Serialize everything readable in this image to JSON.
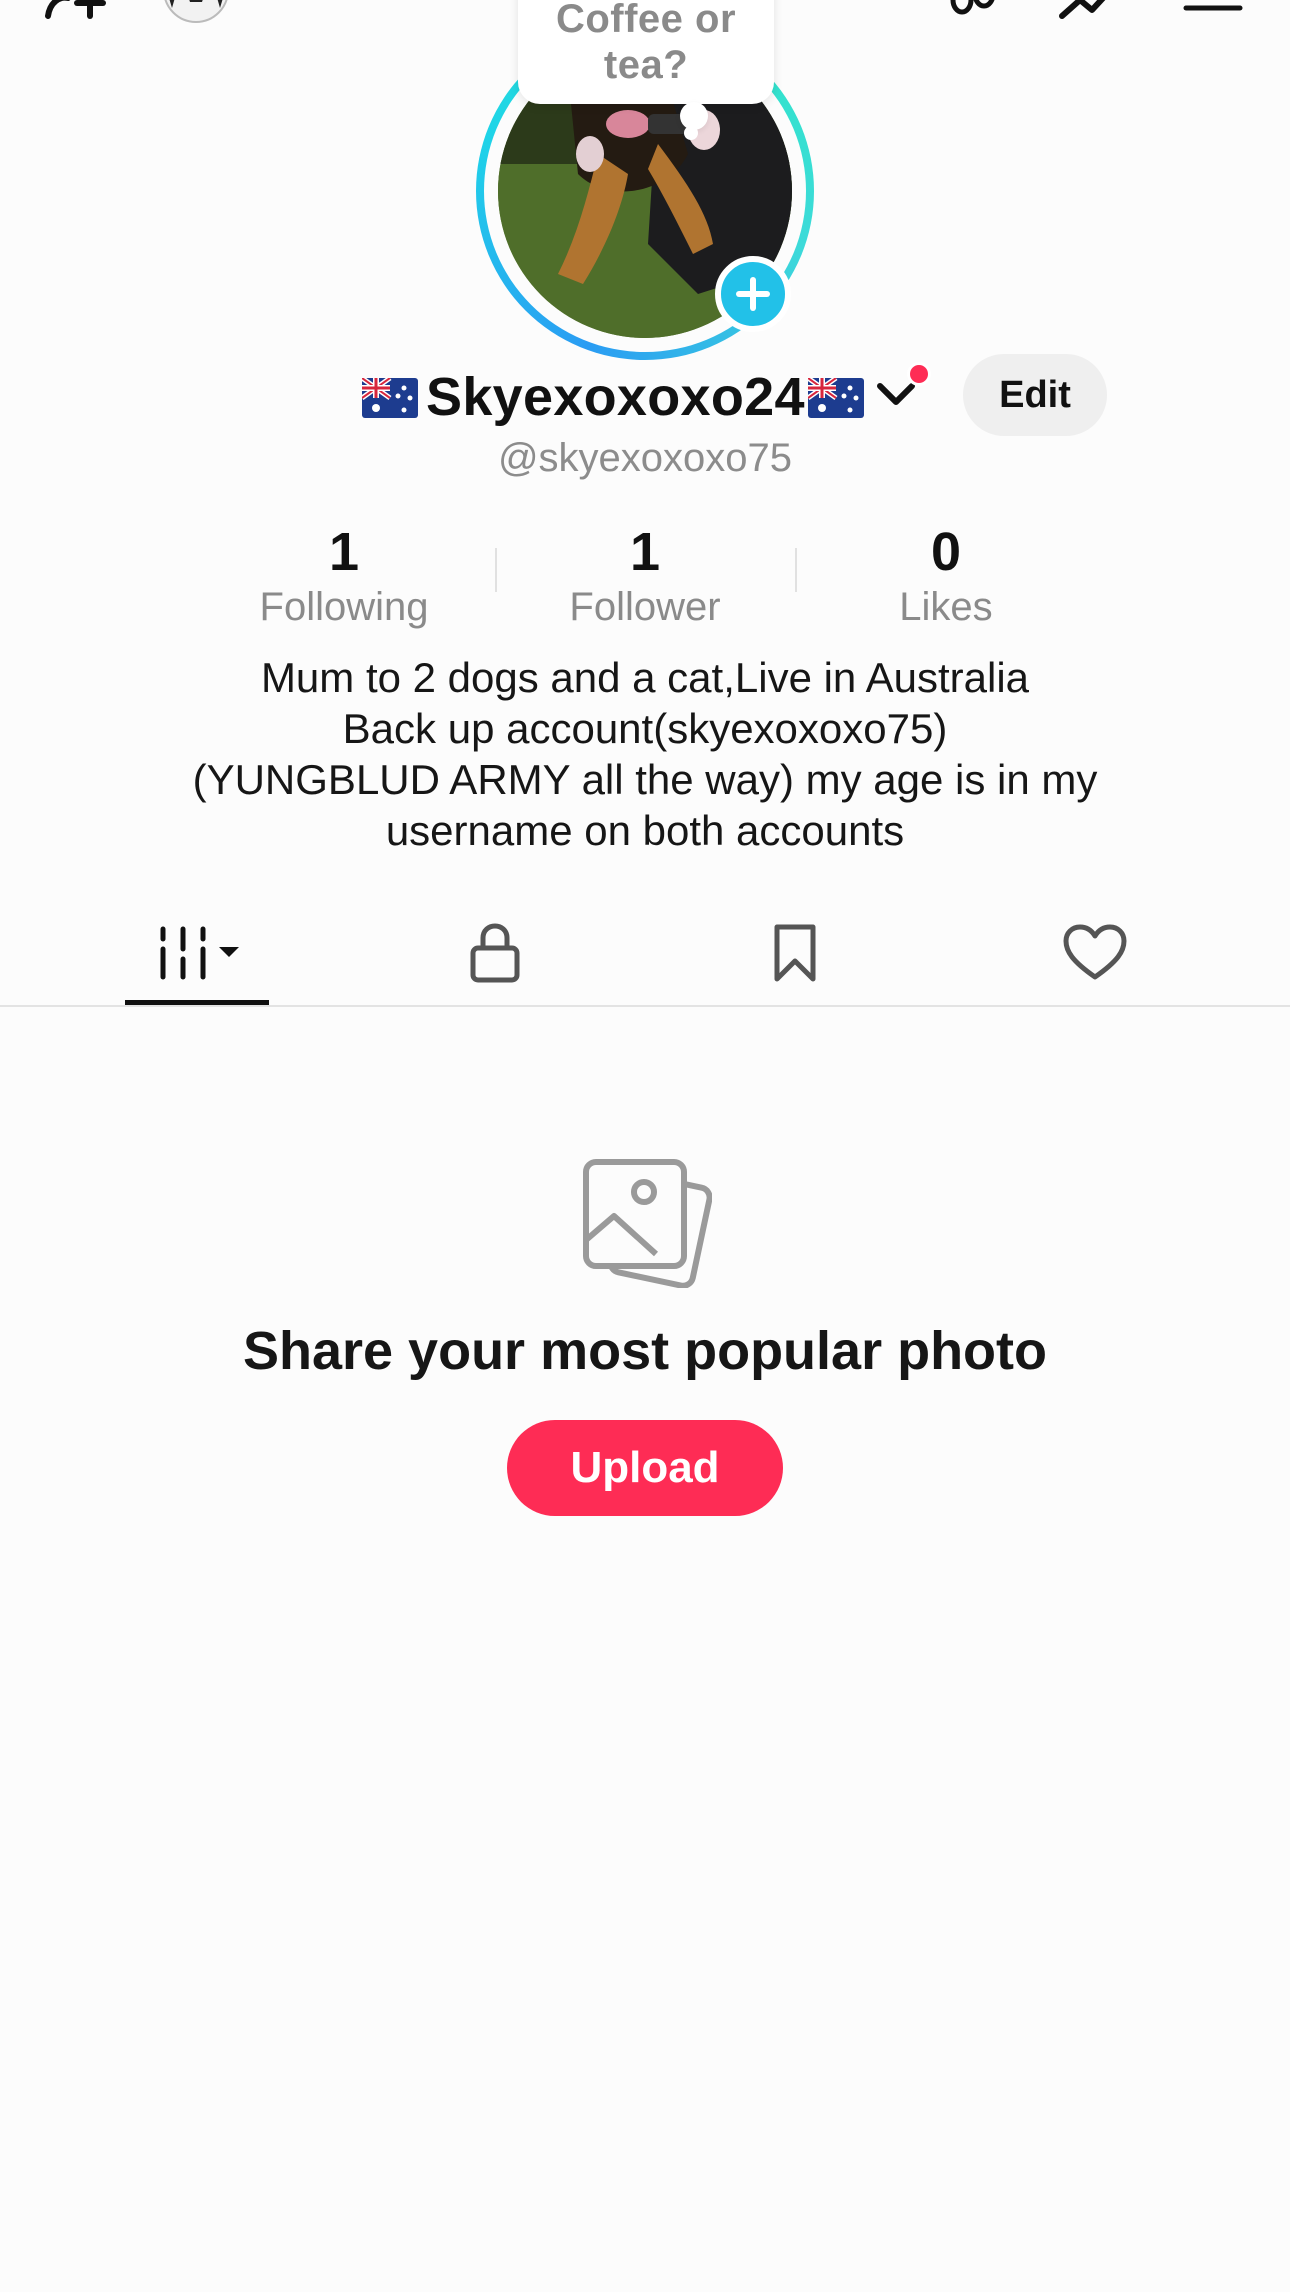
{
  "header": {
    "icons": [
      "add-friend-icon",
      "soccer-ball-avatar-icon",
      "footprint-icon",
      "analytics-icon",
      "menu-icon"
    ]
  },
  "profile": {
    "note_bubble": "Coffee or tea?",
    "display_name": "Skyexoxoxo24",
    "flag_emoji": "🇦🇺",
    "username": "@skyexoxoxo75",
    "edit_label": "Edit",
    "accent_color": "#fe2c55"
  },
  "stats": [
    {
      "value": "1",
      "label": "Following"
    },
    {
      "value": "1",
      "label": "Follower"
    },
    {
      "value": "0",
      "label": "Likes"
    }
  ],
  "bio": [
    "Mum to 2 dogs and a cat,Live in Australia",
    "Back up account(skyexoxoxo75)",
    "(YUNGBLUD ARMY all the way) my age is in my",
    "username on both accounts"
  ],
  "tabs": [
    {
      "name": "videos",
      "icon": "grid-videos-icon",
      "active": true
    },
    {
      "name": "private",
      "icon": "lock-icon",
      "active": false
    },
    {
      "name": "saved",
      "icon": "bookmark-icon",
      "active": false
    },
    {
      "name": "liked",
      "icon": "heart-icon",
      "active": false
    }
  ],
  "empty_state": {
    "title": "Share your most popular photo",
    "button_label": "Upload",
    "icon": "photos-icon"
  }
}
